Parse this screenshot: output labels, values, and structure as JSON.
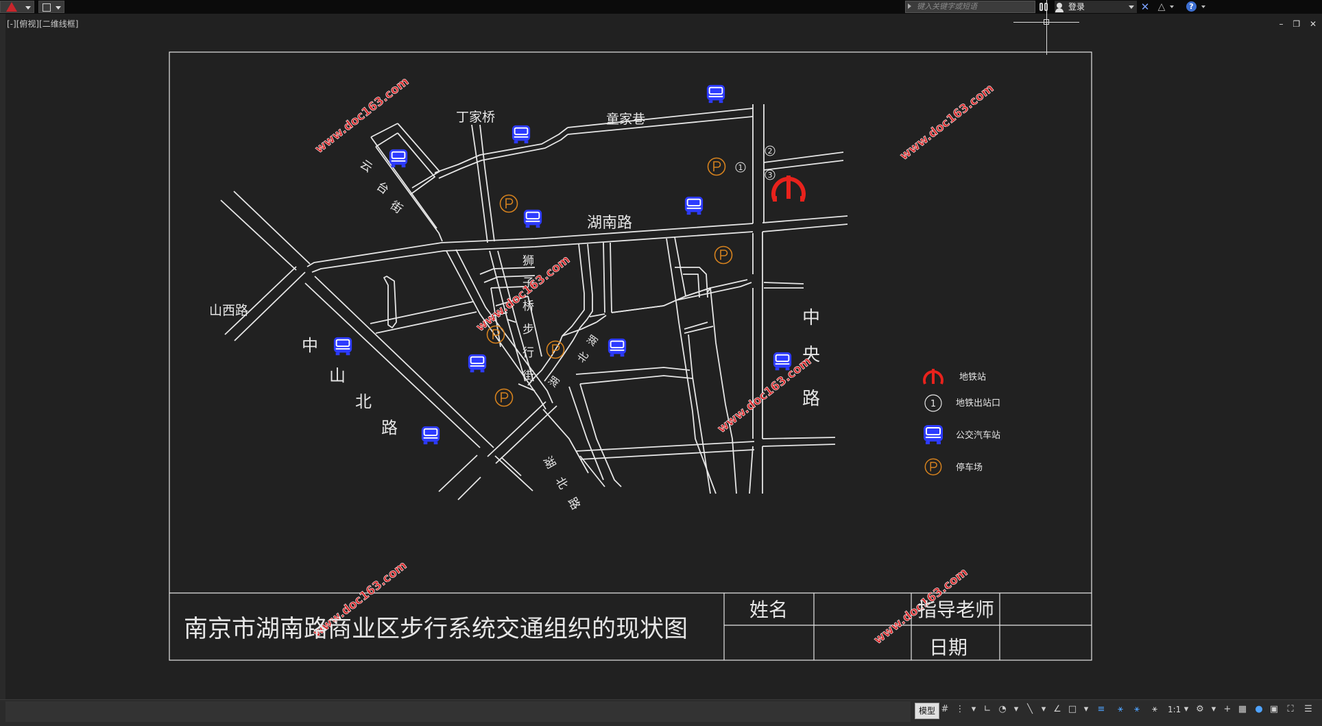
{
  "toolbar": {
    "app_menu_icon": "autocad-logo-icon",
    "quick_access_icon": "save-icon",
    "search_placeholder": "键入关键字或短语",
    "login_label": "登录",
    "exchange_icon": "x-exchange-icon",
    "a360_icon": "a360-icon",
    "help_icon": "help-icon",
    "help_label": "?"
  },
  "viewport": {
    "label": "[-][俯视][二维线框]",
    "minimize": "–",
    "restore": "❐",
    "close": "✕"
  },
  "map": {
    "streets": {
      "dingjiaqiao": "丁家桥",
      "tongjiaxiang": "童家巷",
      "hunanlu": "湖南路",
      "shanxilu": "山西路",
      "zhongshanbeilu": [
        "中",
        "山",
        "北",
        "路"
      ],
      "zhongyanglu": [
        "中",
        "央",
        "路"
      ],
      "shizi_qiao": [
        "狮",
        "子",
        "桥",
        "步",
        "行",
        "街"
      ],
      "yuntai": [
        "云",
        "台",
        "街"
      ],
      "hunanlu_diag": [
        "湖",
        "北",
        "路"
      ],
      "side_road1": [
        "湖",
        "北",
        "路"
      ],
      "side_road2": [
        "湖",
        "北"
      ]
    },
    "subway_exits": [
      "①",
      "②",
      "③"
    ],
    "watermark": "www.doc163.com"
  },
  "legend": {
    "subway": "地铁站",
    "exit_symbol": "1",
    "exit": "地铁出站口",
    "bus": "公交汽车站",
    "parking_symbol": "P",
    "parking": "停车场"
  },
  "title_block": {
    "title": "南京市湖南路商业区步行系统交通组织的现状图",
    "name_label": "姓名",
    "teacher_label": "指导老师",
    "date_label": "日期"
  },
  "status": {
    "model_tab": "模型",
    "scale": "1:1"
  },
  "colors": {
    "background": "#212121",
    "line": "#e6e6e6",
    "subway_red": "#e8221c",
    "bus_blue": "#2d3bff",
    "parking_orange": "#d6821e"
  }
}
